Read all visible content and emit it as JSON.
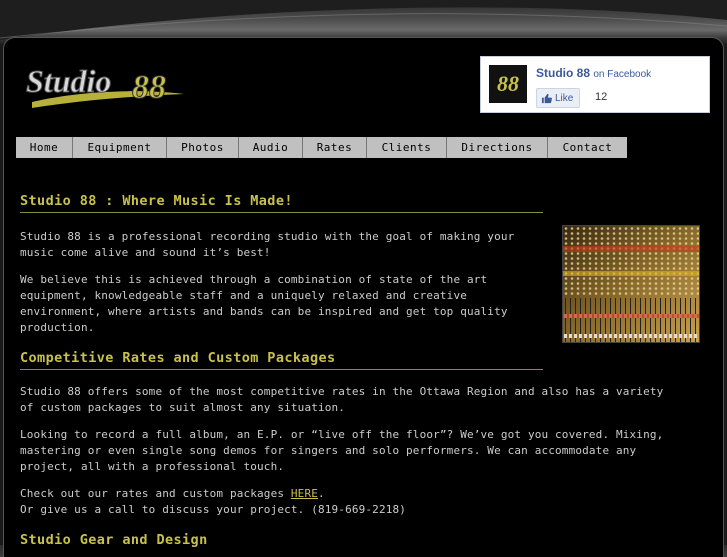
{
  "logo": {
    "text": "Studio 88"
  },
  "facebook": {
    "title": "Studio 88",
    "suffix": "on Facebook",
    "like_label": "Like",
    "like_count": "12",
    "thumb_text": "88"
  },
  "nav": {
    "items": [
      {
        "label": "Home"
      },
      {
        "label": "Equipment"
      },
      {
        "label": "Photos"
      },
      {
        "label": "Audio"
      },
      {
        "label": "Rates"
      },
      {
        "label": "Clients"
      },
      {
        "label": "Directions"
      },
      {
        "label": "Contact"
      }
    ]
  },
  "main": {
    "heading1": "Studio 88 : Where Music Is Made!",
    "p1": "Studio 88 is a professional recording studio with the goal of making your music come alive and sound it’s best!",
    "p2": "We believe this is achieved through a combination of state of the art equipment, knowledgeable staff and a uniquely relaxed and creative environment, where artists and bands can be inspired and get top quality production.",
    "heading2": "Competitive Rates and Custom Packages",
    "p3": "Studio 88 offers some of the most competitive rates in the Ottawa Region and also has a variety of custom packages to suit almost any situation.",
    "p4": "Looking to record a full album, an E.P. or “live off the floor”? We’ve got you covered. Mixing, mastering or even single song demos for singers and solo performers. We can accommodate any project, all with a professional touch.",
    "p5_prefix": "Check out our rates and custom packages ",
    "p5_link": "HERE",
    "p5_suffix": ".",
    "p6": "Or give us a call to discuss your project. (819-669-2218)",
    "heading3": "Studio Gear and Design"
  },
  "colors": {
    "accent": "#c8c24a",
    "background": "#000000",
    "text": "#cccccc",
    "nav_bg": "#c0c0c0"
  }
}
